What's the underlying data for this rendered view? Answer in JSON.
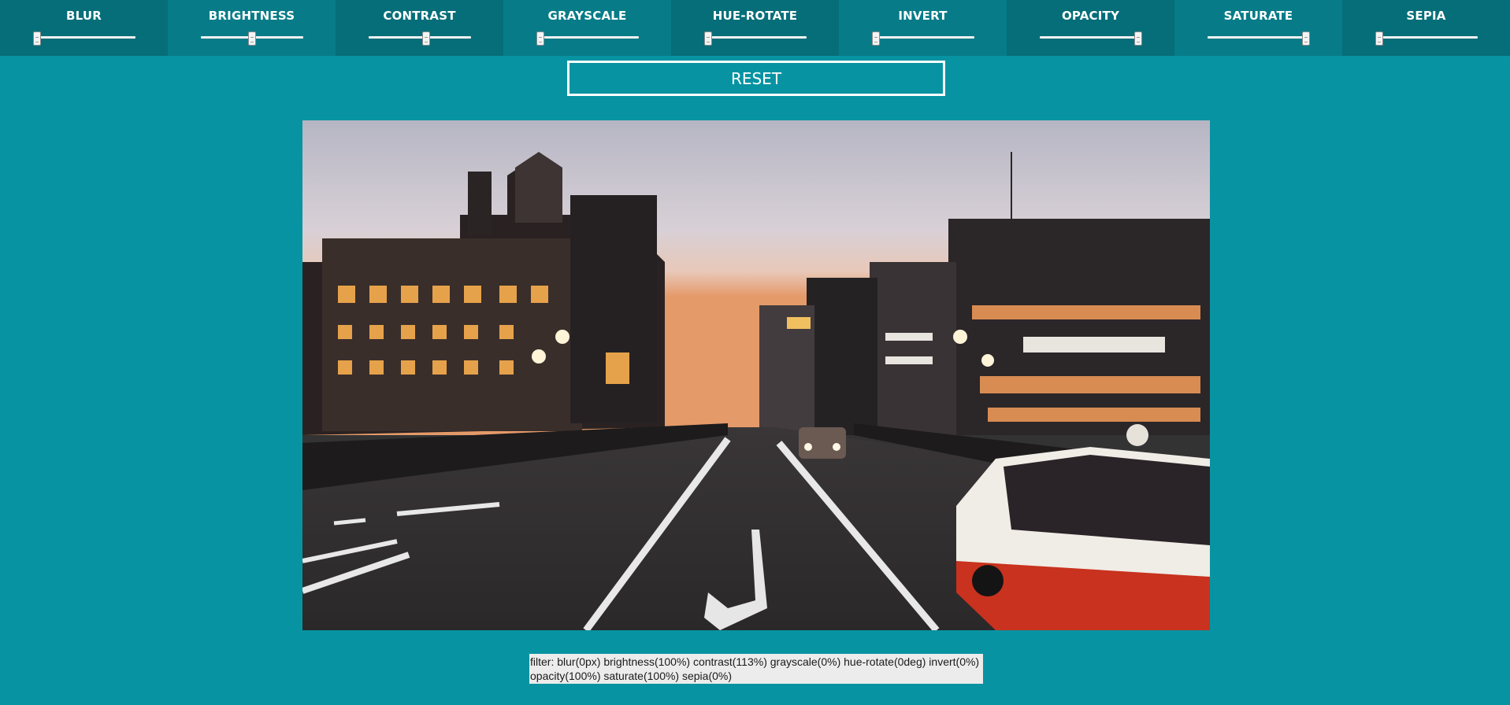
{
  "controls": [
    {
      "label": "BLUR",
      "value": 0,
      "min": 0,
      "max": 10
    },
    {
      "label": "BRIGHTNESS",
      "value": 100,
      "min": 0,
      "max": 200
    },
    {
      "label": "CONTRAST",
      "value": 113,
      "min": 0,
      "max": 200
    },
    {
      "label": "GRAYSCALE",
      "value": 0,
      "min": 0,
      "max": 100
    },
    {
      "label": "HUE-ROTATE",
      "value": 0,
      "min": 0,
      "max": 360
    },
    {
      "label": "INVERT",
      "value": 0,
      "min": 0,
      "max": 100
    },
    {
      "label": "OPACITY",
      "value": 100,
      "min": 0,
      "max": 100
    },
    {
      "label": "SATURATE",
      "value": 100,
      "min": 0,
      "max": 100
    },
    {
      "label": "SEPIA",
      "value": 0,
      "min": 0,
      "max": 100
    }
  ],
  "reset_label": "RESET",
  "filter_text": "filter: blur(0px) brightness(100%) contrast(113%) grayscale(0%) hue-rotate(0deg) invert(0%) opacity(100%) saturate(100%) sepia(0%)",
  "colors": {
    "background": "#0893a2",
    "panel_dark": "#066e79",
    "panel_mid": "#077c88"
  }
}
